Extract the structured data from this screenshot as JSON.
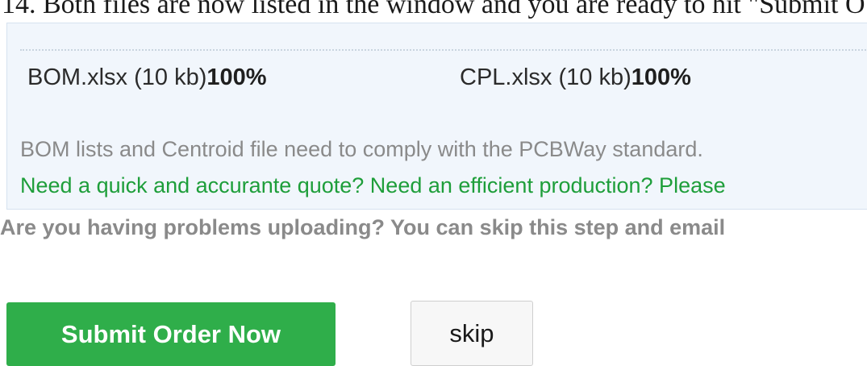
{
  "instruction": {
    "text": "14. Both files are now listed in the window and you are ready to hit \"Submit O"
  },
  "upload_box": {
    "files": [
      {
        "name": "BOM.xlsx (10 kb)",
        "progress": "100%"
      },
      {
        "name": "CPL.xlsx (10 kb)",
        "progress": "100%"
      }
    ],
    "note": "BOM lists and Centroid file need to comply with the PCBWay standard.",
    "promo": "Need a quick and accurante quote? Need an efficient production? Please"
  },
  "problem_text": "Are you having problems uploading? You can skip this step and email",
  "actions": {
    "submit_label": "Submit Order Now",
    "skip_label": "skip"
  },
  "colors": {
    "accent_green": "#2fae4a",
    "promo_green": "#1e9e3a",
    "panel_bg": "#f1f6fc"
  }
}
